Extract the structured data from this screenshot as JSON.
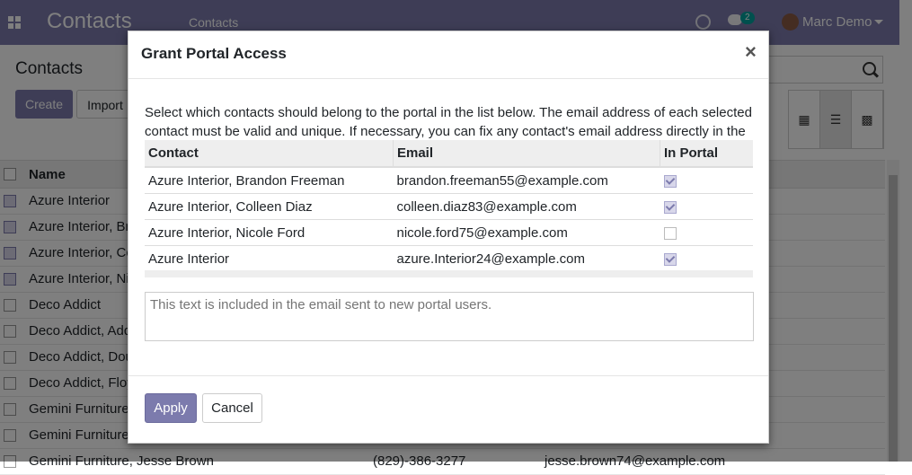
{
  "navbar": {
    "brand": "Contacts",
    "menu_item": "Contacts",
    "chat_count": "2",
    "user_name": "Marc Demo"
  },
  "control_panel": {
    "title": "Contacts",
    "create_label": "Create",
    "import_label": "Import"
  },
  "list": {
    "header_name": "Name",
    "rows": [
      {
        "name": "Azure Interior",
        "checked": true,
        "phone": "",
        "email": ""
      },
      {
        "name": "Azure Interior, Bra",
        "checked": true,
        "phone": "",
        "email": ""
      },
      {
        "name": "Azure Interior, Co",
        "checked": true,
        "phone": "",
        "email": ""
      },
      {
        "name": "Azure Interior, Nic",
        "checked": true,
        "phone": "",
        "email": ""
      },
      {
        "name": "Deco Addict",
        "checked": false,
        "phone": "",
        "email": ""
      },
      {
        "name": "Deco Addict, Addi",
        "checked": false,
        "phone": "",
        "email": ""
      },
      {
        "name": "Deco Addict, Dou",
        "checked": false,
        "phone": "",
        "email": ""
      },
      {
        "name": "Deco Addict, Floy",
        "checked": false,
        "phone": "",
        "email": ""
      },
      {
        "name": "Gemini Furniture",
        "checked": false,
        "phone": "",
        "email": ""
      },
      {
        "name": "Gemini Furniture,",
        "checked": false,
        "phone": "",
        "email": ""
      },
      {
        "name": "Gemini Furniture, Jesse Brown",
        "checked": false,
        "phone": "(829)-386-3277",
        "email": "jesse.brown74@example.com"
      }
    ]
  },
  "dialog": {
    "title": "Grant Portal Access",
    "close_symbol": "×",
    "intro": "Select which contacts should belong to the portal in the list below. The email address of each selected contact must be valid and unique. If necessary, you can fix any contact's email address directly in the list.",
    "columns": [
      "Contact",
      "Email",
      "In Portal"
    ],
    "rows": [
      {
        "contact": "Azure Interior, Brandon Freeman",
        "email": "brandon.freeman55@example.com",
        "in_portal": true
      },
      {
        "contact": "Azure Interior, Colleen Diaz",
        "email": "colleen.diaz83@example.com",
        "in_portal": true
      },
      {
        "contact": "Azure Interior, Nicole Ford",
        "email": "nicole.ford75@example.com",
        "in_portal": false
      },
      {
        "contact": "Azure Interior",
        "email": "azure.Interior24@example.com",
        "in_portal": true
      }
    ],
    "message_placeholder": "This text is included in the email sent to new portal users.",
    "apply_label": "Apply",
    "cancel_label": "Cancel"
  },
  "colors": {
    "brand": "#7c7bad",
    "badge": "#00a09d"
  }
}
